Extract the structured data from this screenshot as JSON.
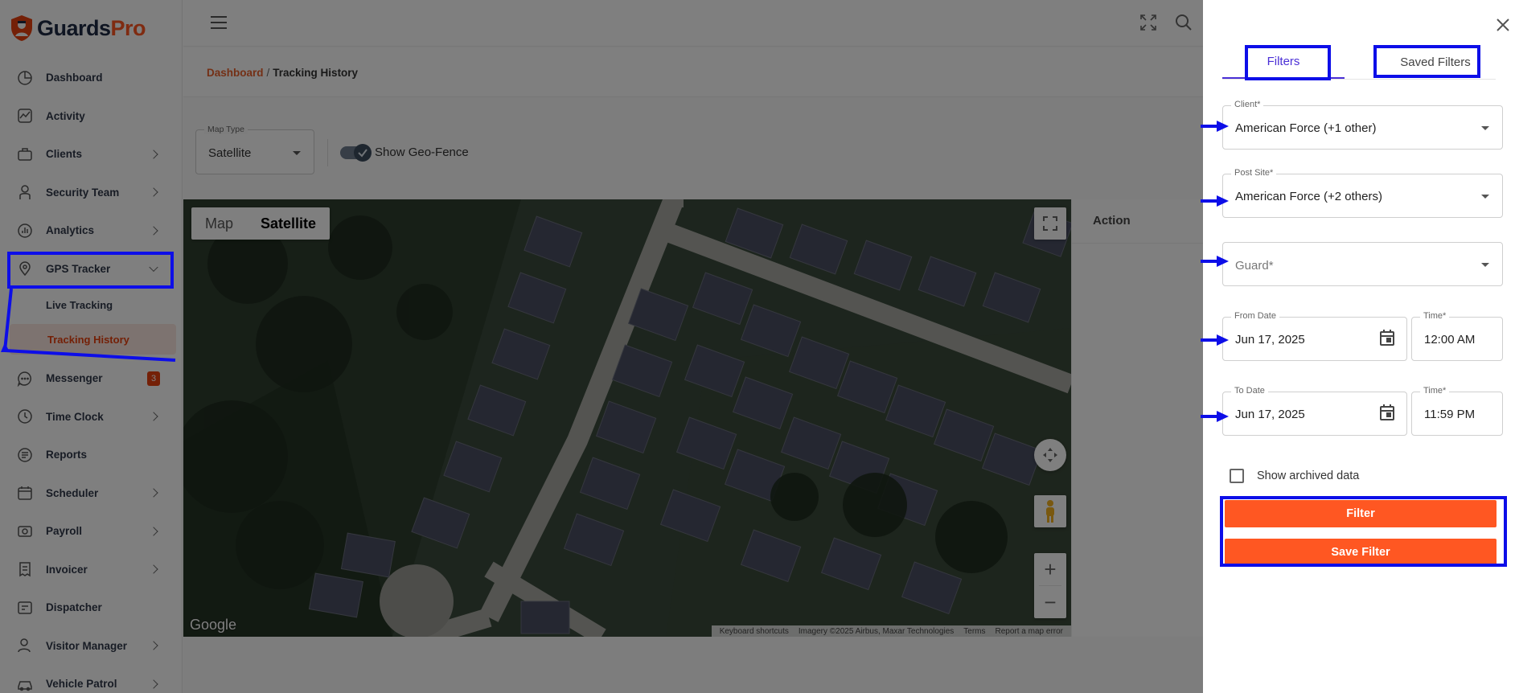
{
  "brand": {
    "name_main": "Guards",
    "name_accent": "Pro"
  },
  "sidebar": {
    "items": [
      {
        "label": "Dashboard",
        "icon": "dashboard-icon",
        "has_chevron": false
      },
      {
        "label": "Activity",
        "icon": "activity-icon",
        "has_chevron": false
      },
      {
        "label": "Clients",
        "icon": "clients-icon",
        "has_chevron": true
      },
      {
        "label": "Security Team",
        "icon": "security-team-icon",
        "has_chevron": true
      },
      {
        "label": "Analytics",
        "icon": "analytics-icon",
        "has_chevron": true
      },
      {
        "label": "GPS Tracker",
        "icon": "location-pin-icon",
        "has_chevron": true,
        "expanded": true
      },
      {
        "label": "Messenger",
        "icon": "chat-icon",
        "badge": "3"
      },
      {
        "label": "Time Clock",
        "icon": "clock-icon",
        "has_chevron": true
      },
      {
        "label": "Reports",
        "icon": "reports-icon",
        "has_chevron": false
      },
      {
        "label": "Scheduler",
        "icon": "calendar-icon",
        "has_chevron": true
      },
      {
        "label": "Payroll",
        "icon": "payroll-icon",
        "has_chevron": true
      },
      {
        "label": "Invoicer",
        "icon": "invoice-icon",
        "has_chevron": true
      },
      {
        "label": "Dispatcher",
        "icon": "dispatcher-icon",
        "has_chevron": false
      },
      {
        "label": "Visitor Manager",
        "icon": "visitor-icon",
        "has_chevron": true
      },
      {
        "label": "Vehicle Patrol",
        "icon": "vehicle-icon",
        "has_chevron": true
      }
    ],
    "gps_sub": [
      {
        "label": "Live Tracking",
        "active": false
      },
      {
        "label": "Tracking History",
        "active": true
      }
    ]
  },
  "breadcrumb": {
    "home": "Dashboard",
    "separator": "/",
    "current": "Tracking History"
  },
  "map_controls": {
    "map_type_label": "Map Type",
    "map_type_value": "Satellite",
    "geofence_label": "Show Geo-Fence",
    "geofence_on": true
  },
  "map": {
    "tab_map": "Map",
    "tab_satellite": "Satellite",
    "google": "Google",
    "attribution": [
      "Keyboard shortcuts",
      "Imagery ©2025 Airbus, Maxar Technologies",
      "Terms",
      "Report a map error"
    ]
  },
  "action_panel": {
    "header": "Action"
  },
  "drawer": {
    "tabs": {
      "filters": "Filters",
      "saved": "Saved Filters"
    },
    "client": {
      "label": "Client*",
      "value": "American Force (+1 other)"
    },
    "post_site": {
      "label": "Post Site*",
      "value": "American Force (+2 others)"
    },
    "guard": {
      "placeholder": "Guard*"
    },
    "from_date": {
      "label": "From Date",
      "value": "Jun 17, 2025"
    },
    "from_time": {
      "label": "Time*",
      "value": "12:00 AM"
    },
    "to_date": {
      "label": "To Date",
      "value": "Jun 17, 2025"
    },
    "to_time": {
      "label": "Time*",
      "value": "11:59 PM"
    },
    "archived_label": "Show archived data",
    "filter_btn": "Filter",
    "save_btn": "Save Filter"
  },
  "colors": {
    "accent": "#ff5722",
    "annotation": "#0d0ee8",
    "tab_active": "#4a2fd6"
  }
}
